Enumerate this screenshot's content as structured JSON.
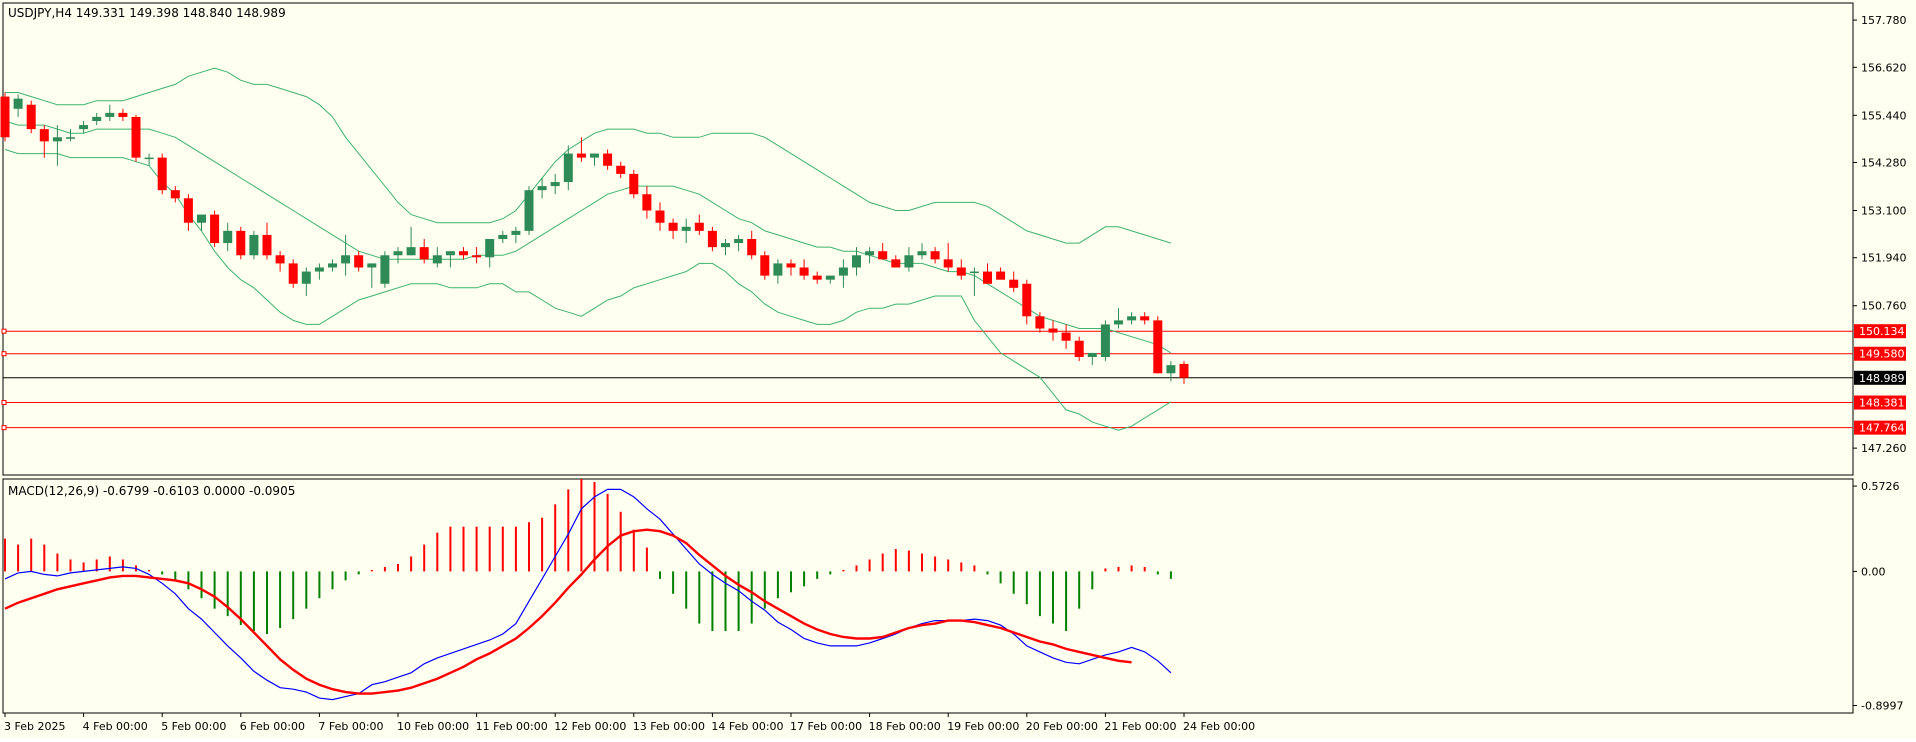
{
  "colors": {
    "background": "#fffff0",
    "frame": "#000000",
    "bull": "#2e8b57",
    "bear": "#ff0000",
    "bollinger": "#3cb371",
    "level": "#ff0000",
    "price_line": "#000000",
    "macd_line": "#0000ff",
    "signal_line": "#ff0000",
    "hist_pos": "#ff0000",
    "hist_neg": "#008000"
  },
  "symbol_header": "USDJPY,H4  149.331 149.398 148.840 148.989",
  "macd_header": "MACD(12,26,9) -0.6799 -0.6103 0.0000 -0.0905",
  "levels": [
    {
      "value": 150.134,
      "label": "150.134"
    },
    {
      "value": 149.58,
      "label": "149.580"
    },
    {
      "value": 148.381,
      "label": "148.381"
    },
    {
      "value": 147.764,
      "label": "147.764"
    }
  ],
  "current_price": {
    "value": 148.989,
    "label": "148.989"
  },
  "chart_data": [
    {
      "type": "candlestick",
      "title": "USDJPY,H4",
      "ylim": [
        146.6,
        158.2
      ],
      "y_ticks": [
        "157.780",
        "156.620",
        "155.440",
        "154.280",
        "153.100",
        "151.940",
        "150.760",
        "147.260"
      ],
      "y_tick_values": [
        157.78,
        156.62,
        155.44,
        154.28,
        153.1,
        151.94,
        150.76,
        147.26
      ],
      "x_ticks": [
        "3 Feb 2025",
        "4 Feb 00:00",
        "5 Feb 00:00",
        "6 Feb 00:00",
        "7 Feb 00:00",
        "10 Feb 00:00",
        "11 Feb 00:00",
        "12 Feb 00:00",
        "13 Feb 00:00",
        "14 Feb 00:00",
        "17 Feb 00:00",
        "18 Feb 00:00",
        "19 Feb 00:00",
        "20 Feb 00:00",
        "21 Feb 00:00",
        "24 Feb 00:00"
      ],
      "x_tick_bars": [
        0,
        6,
        12,
        18,
        24,
        30,
        36,
        42,
        48,
        54,
        60,
        66,
        72,
        78,
        84,
        90
      ],
      "ohlc": [
        [
          155.9,
          156.0,
          154.8,
          154.9
        ],
        [
          155.6,
          155.95,
          155.4,
          155.85
        ],
        [
          155.7,
          155.8,
          155.0,
          155.1
        ],
        [
          155.1,
          155.2,
          154.4,
          154.8
        ],
        [
          154.8,
          155.2,
          154.2,
          154.9
        ],
        [
          154.9,
          155.1,
          154.8,
          154.9
        ],
        [
          155.1,
          155.3,
          155.0,
          155.2
        ],
        [
          155.3,
          155.5,
          155.2,
          155.4
        ],
        [
          155.4,
          155.7,
          155.3,
          155.5
        ],
        [
          155.5,
          155.6,
          155.3,
          155.4
        ],
        [
          155.4,
          155.45,
          154.3,
          154.4
        ],
        [
          154.4,
          154.5,
          154.2,
          154.4
        ],
        [
          154.4,
          154.5,
          153.5,
          153.6
        ],
        [
          153.6,
          153.7,
          153.3,
          153.4
        ],
        [
          153.4,
          153.5,
          152.6,
          152.8
        ],
        [
          152.8,
          153.0,
          152.6,
          153.0
        ],
        [
          153.0,
          153.1,
          152.2,
          152.3
        ],
        [
          152.3,
          152.8,
          152.1,
          152.6
        ],
        [
          152.6,
          152.7,
          151.9,
          152.0
        ],
        [
          152.0,
          152.6,
          151.9,
          152.5
        ],
        [
          152.5,
          152.8,
          151.9,
          152.0
        ],
        [
          152.0,
          152.1,
          151.6,
          151.8
        ],
        [
          151.8,
          151.9,
          151.2,
          151.3
        ],
        [
          151.3,
          151.7,
          151.0,
          151.6
        ],
        [
          151.6,
          151.8,
          151.4,
          151.7
        ],
        [
          151.7,
          151.9,
          151.6,
          151.8
        ],
        [
          151.8,
          152.5,
          151.5,
          152.0
        ],
        [
          152.0,
          152.1,
          151.6,
          151.7
        ],
        [
          151.7,
          151.8,
          151.2,
          151.8
        ],
        [
          151.3,
          152.1,
          151.2,
          152.0
        ],
        [
          152.0,
          152.2,
          151.8,
          152.1
        ],
        [
          152.0,
          152.7,
          152.0,
          152.2
        ],
        [
          152.2,
          152.4,
          151.8,
          151.9
        ],
        [
          151.8,
          152.2,
          151.7,
          152.0
        ],
        [
          152.0,
          152.1,
          151.7,
          152.1
        ],
        [
          152.1,
          152.2,
          151.9,
          152.0
        ],
        [
          152.0,
          152.2,
          151.8,
          151.95
        ],
        [
          151.95,
          152.1,
          151.7,
          152.4
        ],
        [
          152.4,
          152.6,
          152.3,
          152.5
        ],
        [
          152.5,
          152.7,
          152.3,
          152.6
        ],
        [
          152.6,
          153.7,
          152.5,
          153.6
        ],
        [
          153.6,
          153.9,
          153.4,
          153.7
        ],
        [
          153.7,
          154.0,
          153.5,
          153.8
        ],
        [
          153.8,
          154.7,
          153.6,
          154.5
        ],
        [
          154.5,
          154.9,
          154.3,
          154.4
        ],
        [
          154.4,
          154.5,
          154.2,
          154.5
        ],
        [
          154.5,
          154.6,
          154.1,
          154.2
        ],
        [
          154.2,
          154.3,
          153.9,
          154.0
        ],
        [
          154.0,
          154.1,
          153.4,
          153.5
        ],
        [
          153.5,
          153.7,
          152.9,
          153.1
        ],
        [
          153.1,
          153.3,
          152.6,
          152.8
        ],
        [
          152.8,
          152.9,
          152.4,
          152.6
        ],
        [
          152.6,
          152.9,
          152.3,
          152.7
        ],
        [
          152.8,
          153.0,
          152.5,
          152.6
        ],
        [
          152.6,
          152.7,
          152.1,
          152.2
        ],
        [
          152.2,
          152.4,
          152.0,
          152.3
        ],
        [
          152.3,
          152.5,
          152.1,
          152.4
        ],
        [
          152.4,
          152.6,
          151.9,
          152.0
        ],
        [
          152.0,
          152.1,
          151.4,
          151.5
        ],
        [
          151.5,
          151.9,
          151.3,
          151.8
        ],
        [
          151.8,
          151.9,
          151.5,
          151.7
        ],
        [
          151.7,
          151.9,
          151.4,
          151.5
        ],
        [
          151.5,
          151.6,
          151.3,
          151.4
        ],
        [
          151.4,
          151.5,
          151.3,
          151.5
        ],
        [
          151.5,
          151.9,
          151.2,
          151.7
        ],
        [
          151.7,
          152.2,
          151.5,
          152.0
        ],
        [
          152.0,
          152.2,
          151.8,
          152.1
        ],
        [
          152.1,
          152.3,
          151.9,
          151.9
        ],
        [
          151.9,
          152.0,
          151.7,
          151.7
        ],
        [
          151.7,
          152.2,
          151.6,
          152.0
        ],
        [
          152.0,
          152.3,
          151.9,
          152.1
        ],
        [
          152.1,
          152.2,
          151.8,
          151.9
        ],
        [
          151.9,
          152.3,
          151.6,
          151.7
        ],
        [
          151.7,
          151.9,
          151.4,
          151.5
        ],
        [
          151.6,
          151.7,
          151.0,
          151.6
        ],
        [
          151.6,
          151.8,
          151.3,
          151.3
        ],
        [
          151.6,
          151.7,
          151.5,
          151.4
        ],
        [
          151.4,
          151.6,
          151.1,
          151.2
        ],
        [
          151.3,
          151.4,
          150.3,
          150.5
        ],
        [
          150.5,
          150.6,
          150.1,
          150.2
        ],
        [
          150.2,
          150.4,
          149.9,
          150.1
        ],
        [
          150.1,
          150.3,
          149.7,
          149.9
        ],
        [
          149.9,
          150.0,
          149.4,
          149.5
        ],
        [
          149.5,
          149.6,
          149.3,
          149.6
        ],
        [
          149.5,
          150.4,
          149.4,
          150.3
        ],
        [
          150.3,
          150.7,
          150.2,
          150.4
        ],
        [
          150.4,
          150.6,
          150.3,
          150.5
        ],
        [
          150.5,
          150.6,
          150.3,
          150.4
        ],
        [
          150.4,
          150.5,
          149.1,
          149.1
        ],
        [
          149.1,
          149.4,
          148.9,
          149.3
        ],
        [
          149.33,
          149.4,
          148.84,
          148.99
        ]
      ],
      "bollinger_upper": [
        156.0,
        156.0,
        155.9,
        155.8,
        155.7,
        155.7,
        155.7,
        155.8,
        155.8,
        155.8,
        155.9,
        156.0,
        156.1,
        156.2,
        156.4,
        156.5,
        156.6,
        156.5,
        156.3,
        156.2,
        156.2,
        156.1,
        156.0,
        155.9,
        155.7,
        155.4,
        154.9,
        154.5,
        154.1,
        153.7,
        153.3,
        153.0,
        152.9,
        152.8,
        152.8,
        152.8,
        152.8,
        152.8,
        152.9,
        153.1,
        153.5,
        153.9,
        154.3,
        154.6,
        154.8,
        155.0,
        155.1,
        155.1,
        155.1,
        155.0,
        155.0,
        154.9,
        154.9,
        154.9,
        155.0,
        155.0,
        155.0,
        155.0,
        154.9,
        154.7,
        154.5,
        154.3,
        154.1,
        153.9,
        153.7,
        153.5,
        153.3,
        153.2,
        153.1,
        153.1,
        153.2,
        153.3,
        153.3,
        153.3,
        153.3,
        153.2,
        153.0,
        152.8,
        152.6,
        152.5,
        152.4,
        152.3,
        152.3,
        152.5,
        152.7,
        152.7,
        152.6,
        152.5,
        152.4,
        152.3
      ],
      "bollinger_middle": [
        155.3,
        155.2,
        155.2,
        155.2,
        155.1,
        155.0,
        155.0,
        155.1,
        155.1,
        155.1,
        155.1,
        155.1,
        155.0,
        154.9,
        154.7,
        154.5,
        154.3,
        154.1,
        153.9,
        153.7,
        153.5,
        153.3,
        153.1,
        152.9,
        152.7,
        152.5,
        152.3,
        152.1,
        152.0,
        151.9,
        151.9,
        151.9,
        151.9,
        151.9,
        151.9,
        151.9,
        152.0,
        152.0,
        152.0,
        152.1,
        152.3,
        152.5,
        152.7,
        152.9,
        153.1,
        153.3,
        153.5,
        153.6,
        153.7,
        153.7,
        153.7,
        153.7,
        153.6,
        153.5,
        153.3,
        153.1,
        152.9,
        152.8,
        152.6,
        152.5,
        152.4,
        152.3,
        152.2,
        152.2,
        152.1,
        152.1,
        152.0,
        151.9,
        151.8,
        151.8,
        151.8,
        151.7,
        151.6,
        151.6,
        151.5,
        151.3,
        151.1,
        150.9,
        150.7,
        150.5,
        150.4,
        150.3,
        150.2,
        150.2,
        150.2,
        150.1,
        150.0,
        149.9,
        149.8,
        149.6
      ],
      "bollinger_lower": [
        154.6,
        154.5,
        154.5,
        154.5,
        154.5,
        154.4,
        154.4,
        154.4,
        154.4,
        154.4,
        154.3,
        154.2,
        153.8,
        153.5,
        153.0,
        152.6,
        152.1,
        151.7,
        151.4,
        151.2,
        150.9,
        150.6,
        150.4,
        150.3,
        150.3,
        150.5,
        150.7,
        150.9,
        151.0,
        151.1,
        151.2,
        151.3,
        151.3,
        151.3,
        151.2,
        151.2,
        151.2,
        151.3,
        151.3,
        151.1,
        151.1,
        150.9,
        150.7,
        150.6,
        150.5,
        150.7,
        150.9,
        151.0,
        151.2,
        151.3,
        151.4,
        151.5,
        151.6,
        151.8,
        151.8,
        151.6,
        151.3,
        151.1,
        150.8,
        150.6,
        150.5,
        150.4,
        150.3,
        150.3,
        150.4,
        150.6,
        150.7,
        150.7,
        150.8,
        150.8,
        150.9,
        151.0,
        151.0,
        151.0,
        150.4,
        150.0,
        149.6,
        149.4,
        149.2,
        149.0,
        148.6,
        148.2,
        148.1,
        147.9,
        147.8,
        147.7,
        147.8,
        148.0,
        148.2,
        148.4
      ]
    },
    {
      "type": "macd",
      "title": "MACD(12,26,9)",
      "ylim": [
        -0.95,
        0.62
      ],
      "y_ticks": [
        "0.5726",
        "0.00",
        "-0.8997"
      ],
      "y_tick_values": [
        0.5726,
        0.0,
        -0.8997
      ],
      "histogram": [
        0.22,
        0.18,
        0.22,
        0.18,
        0.12,
        0.08,
        0.06,
        0.08,
        0.1,
        0.08,
        0.04,
        0.01,
        -0.02,
        -0.06,
        -0.12,
        -0.18,
        -0.25,
        -0.3,
        -0.36,
        -0.4,
        -0.42,
        -0.38,
        -0.32,
        -0.25,
        -0.18,
        -0.12,
        -0.06,
        -0.02,
        0.01,
        0.03,
        0.05,
        0.1,
        0.18,
        0.26,
        0.3,
        0.3,
        0.3,
        0.3,
        0.3,
        0.3,
        0.33,
        0.36,
        0.45,
        0.55,
        0.62,
        0.6,
        0.52,
        0.4,
        0.28,
        0.16,
        -0.05,
        -0.15,
        -0.25,
        -0.35,
        -0.4,
        -0.4,
        -0.4,
        -0.35,
        -0.25,
        -0.18,
        -0.14,
        -0.1,
        -0.05,
        -0.02,
        0.01,
        0.04,
        0.08,
        0.12,
        0.15,
        0.14,
        0.12,
        0.1,
        0.08,
        0.06,
        0.04,
        -0.02,
        -0.08,
        -0.15,
        -0.22,
        -0.3,
        -0.35,
        -0.4,
        -0.25,
        -0.12,
        0.02,
        0.03,
        0.04,
        0.03,
        -0.02,
        -0.05
      ],
      "macd": [
        -0.05,
        -0.01,
        0.0,
        -0.02,
        -0.03,
        -0.01,
        0.0,
        0.01,
        0.02,
        0.03,
        0.02,
        -0.02,
        -0.08,
        -0.15,
        -0.25,
        -0.32,
        -0.41,
        -0.5,
        -0.58,
        -0.67,
        -0.73,
        -0.78,
        -0.79,
        -0.81,
        -0.85,
        -0.86,
        -0.84,
        -0.82,
        -0.76,
        -0.74,
        -0.71,
        -0.68,
        -0.62,
        -0.58,
        -0.55,
        -0.52,
        -0.49,
        -0.46,
        -0.42,
        -0.35,
        -0.2,
        -0.05,
        0.1,
        0.25,
        0.42,
        0.5,
        0.55,
        0.55,
        0.5,
        0.42,
        0.35,
        0.25,
        0.15,
        0.05,
        -0.02,
        -0.08,
        -0.13,
        -0.2,
        -0.26,
        -0.34,
        -0.39,
        -0.45,
        -0.48,
        -0.5,
        -0.5,
        -0.5,
        -0.48,
        -0.45,
        -0.42,
        -0.38,
        -0.35,
        -0.33,
        -0.33,
        -0.33,
        -0.32,
        -0.33,
        -0.36,
        -0.42,
        -0.5,
        -0.54,
        -0.58,
        -0.61,
        -0.62,
        -0.59,
        -0.56,
        -0.54,
        -0.51,
        -0.54,
        -0.6,
        -0.68
      ],
      "signal": [
        -0.25,
        -0.21,
        -0.18,
        -0.15,
        -0.12,
        -0.1,
        -0.08,
        -0.06,
        -0.04,
        -0.03,
        -0.03,
        -0.04,
        -0.05,
        -0.06,
        -0.08,
        -0.12,
        -0.17,
        -0.24,
        -0.32,
        -0.41,
        -0.5,
        -0.59,
        -0.66,
        -0.72,
        -0.76,
        -0.79,
        -0.81,
        -0.82,
        -0.82,
        -0.81,
        -0.8,
        -0.78,
        -0.75,
        -0.72,
        -0.68,
        -0.64,
        -0.59,
        -0.55,
        -0.5,
        -0.45,
        -0.38,
        -0.3,
        -0.21,
        -0.11,
        -0.02,
        0.08,
        0.17,
        0.24,
        0.27,
        0.28,
        0.27,
        0.24,
        0.19,
        0.11,
        0.04,
        -0.03,
        -0.09,
        -0.14,
        -0.2,
        -0.25,
        -0.3,
        -0.35,
        -0.39,
        -0.42,
        -0.44,
        -0.45,
        -0.45,
        -0.44,
        -0.41,
        -0.38,
        -0.36,
        -0.35,
        -0.33,
        -0.33,
        -0.34,
        -0.36,
        -0.38,
        -0.41,
        -0.44,
        -0.47,
        -0.49,
        -0.52,
        -0.54,
        -0.56,
        -0.58,
        -0.6,
        -0.61
      ]
    }
  ]
}
